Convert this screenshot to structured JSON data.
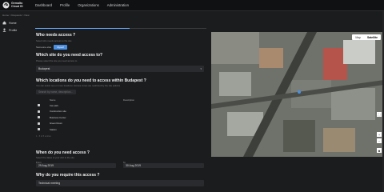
{
  "brand": {
    "line1": "Gemalto",
    "line2": "Cloud ID"
  },
  "nav": [
    "Dashboard",
    "Profile",
    "Organizations",
    "Administration"
  ],
  "breadcrumb": "Home  >  Requests  >  New",
  "sidebar": [
    {
      "label": "Home",
      "icon": "home-icon"
    },
    {
      "label": "Profile",
      "icon": "user-icon"
    }
  ],
  "progress_fraction": 0.55,
  "sections": {
    "who": {
      "title": "Who needs access ?",
      "hint": "Select who needs access to the site",
      "toggle_label": "Someone else",
      "toggle_button": "Myself"
    },
    "site": {
      "title": "Which site do you need access to?",
      "hint": "Please select the site you need access to",
      "value": "Budapest"
    },
    "locations": {
      "title": "Which locations do you need to access within Budapest ?",
      "hint": "You can select one or more locations. Access zones are restricted by the site policies",
      "search_placeholder": "Search by name, description...",
      "columns": [
        "Name",
        "Description"
      ],
      "rows": [
        "Car park",
        "Construction site",
        "Business Center",
        "Green Room",
        "Station"
      ],
      "pager": "1 - 5 of 5 entries"
    },
    "when": {
      "title": "When do you need access ?",
      "hint": "Select the dates of your visit to the site",
      "from_label": "From",
      "from_value": "29 Aug 2019",
      "to_label": "To",
      "to_value": "30 Aug 2019"
    },
    "why": {
      "title": "Why do you require this access ?",
      "value": "Technical meeting"
    }
  },
  "map": {
    "buttons": [
      "Map",
      "Satellite"
    ],
    "active": "Satellite",
    "zoom_in": "+",
    "zoom_out": "−"
  },
  "colors": {
    "accent": "#4a90e2",
    "background": "#1b1c1e"
  }
}
